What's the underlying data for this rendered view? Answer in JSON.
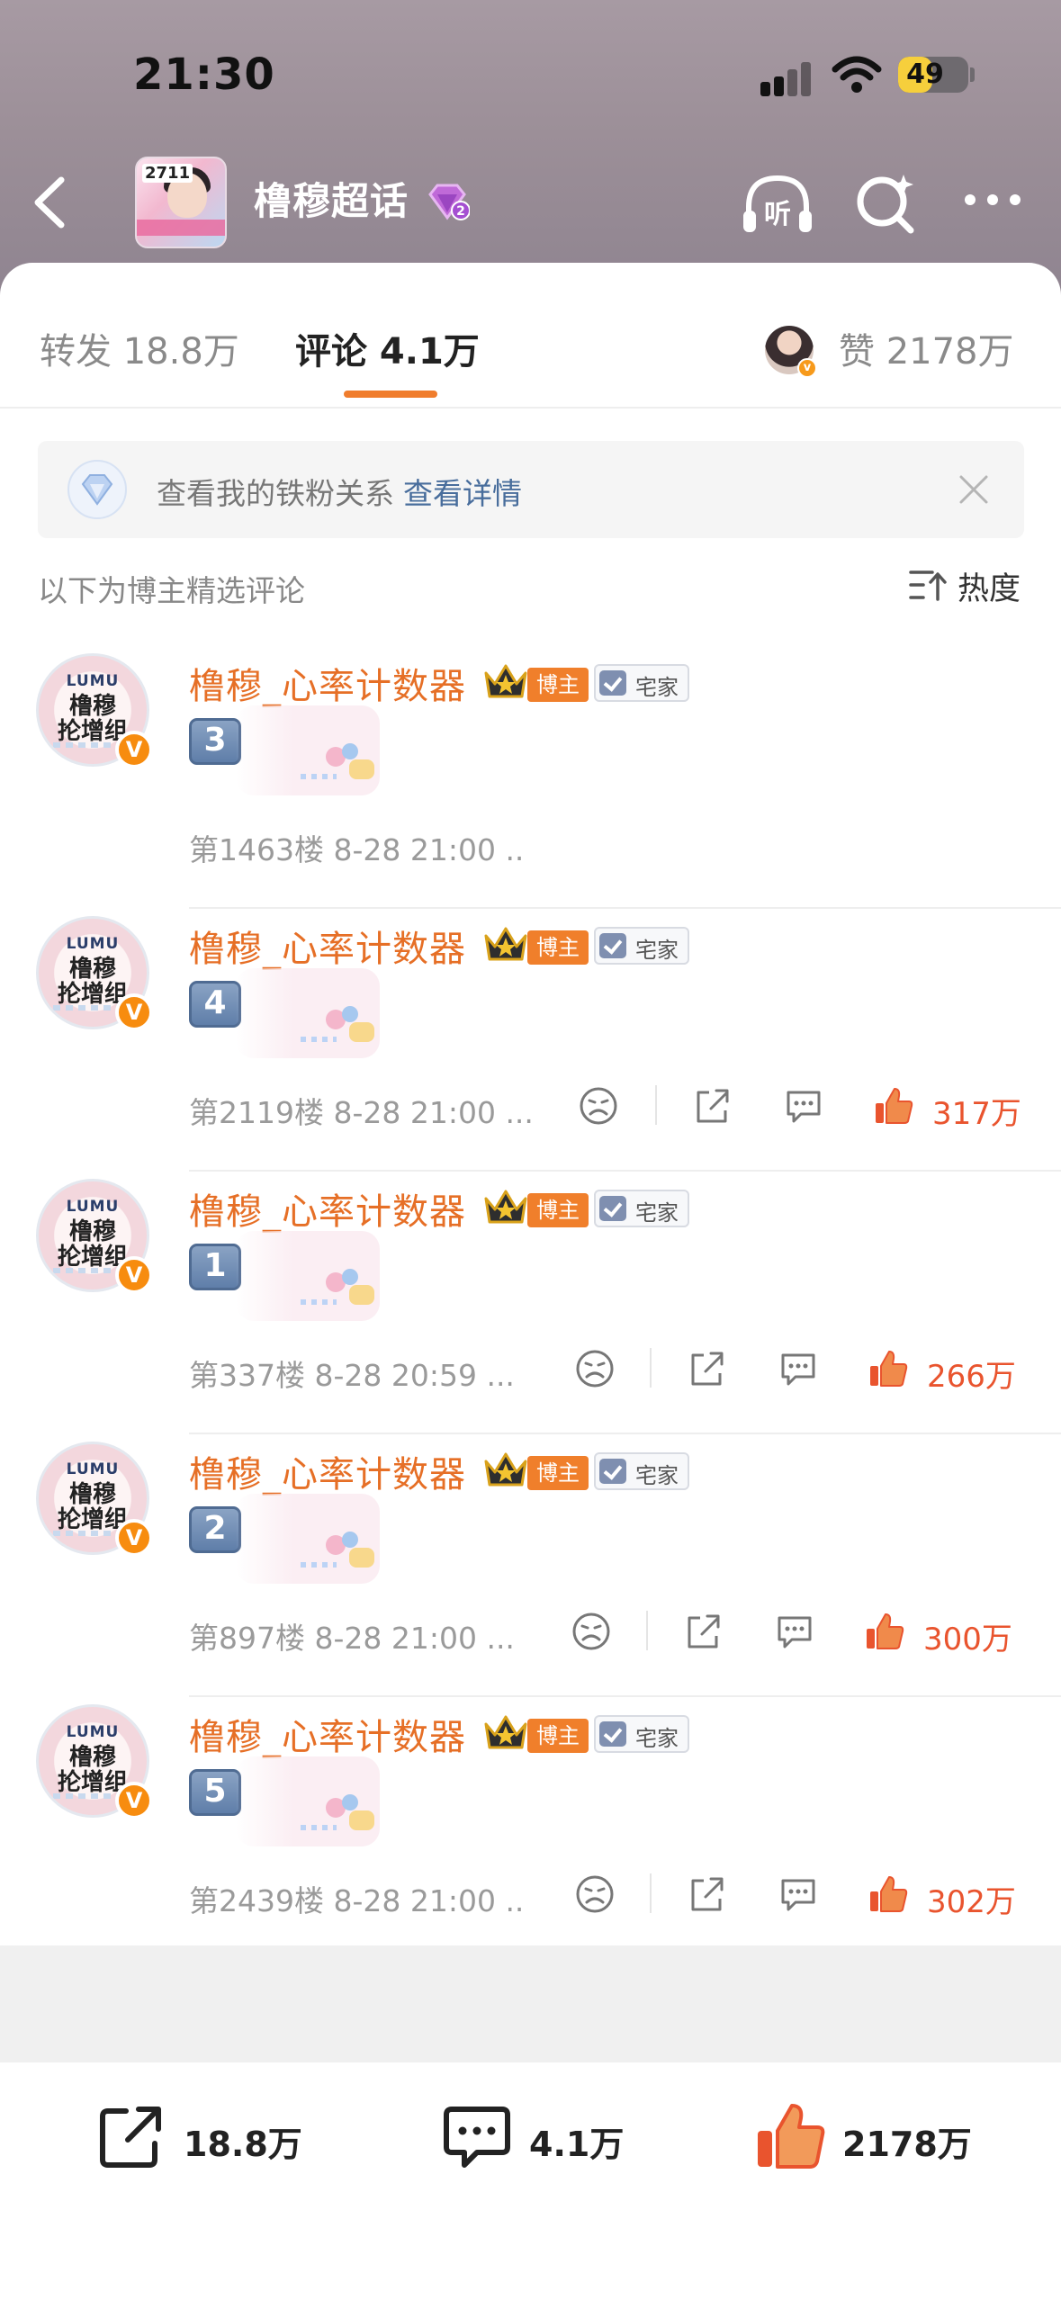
{
  "status_bar": {
    "time": "21:30",
    "battery": "49",
    "battery_fraction": 0.49
  },
  "nav": {
    "title": "橹穆超话",
    "level_badge": "2",
    "thumb_label": "2711"
  },
  "tabs": {
    "repost": "转发 18.8万",
    "comments": "评论 4.1万",
    "likes": "赞 2178万",
    "active": "comments"
  },
  "fan_banner": {
    "text": "查看我的铁粉关系",
    "link": "查看详情"
  },
  "section": {
    "label": "以下为博主精选评论",
    "sort": "热度"
  },
  "badges": {
    "blogger": "博主",
    "zhaijia": "宅家",
    "verified": "V"
  },
  "avatar": {
    "line1": "LUMU",
    "line2": "橹穆",
    "line3": "抡增组"
  },
  "comments": [
    {
      "author": "橹穆_心率计数器",
      "key": "3",
      "meta": "第1463楼 8-28 21:00 ..",
      "likes": ""
    },
    {
      "author": "橹穆_心率计数器",
      "key": "4",
      "meta": "第2119楼 8-28 21:00 ...",
      "likes": "317万"
    },
    {
      "author": "橹穆_心率计数器",
      "key": "1",
      "meta": "第337楼 8-28 20:59 ...",
      "likes": "266万"
    },
    {
      "author": "橹穆_心率计数器",
      "key": "2",
      "meta": "第897楼 8-28 21:00 ...",
      "likes": "300万"
    },
    {
      "author": "橹穆_心率计数器",
      "key": "5",
      "meta": "第2439楼 8-28 21:00 ..",
      "likes": "302万"
    }
  ],
  "bottom_bar": {
    "repost": "18.8万",
    "comment": "4.1万",
    "like": "2178万"
  },
  "colors": {
    "accent": "#f07d2d",
    "name": "#e66f26",
    "like": "#e9542e",
    "link": "#486d9c"
  },
  "icons": [
    "back-icon",
    "listen-icon",
    "search-icon",
    "more-icon",
    "close-icon",
    "sort-icon",
    "dislike-icon",
    "share-icon",
    "comment-icon",
    "like-icon"
  ]
}
